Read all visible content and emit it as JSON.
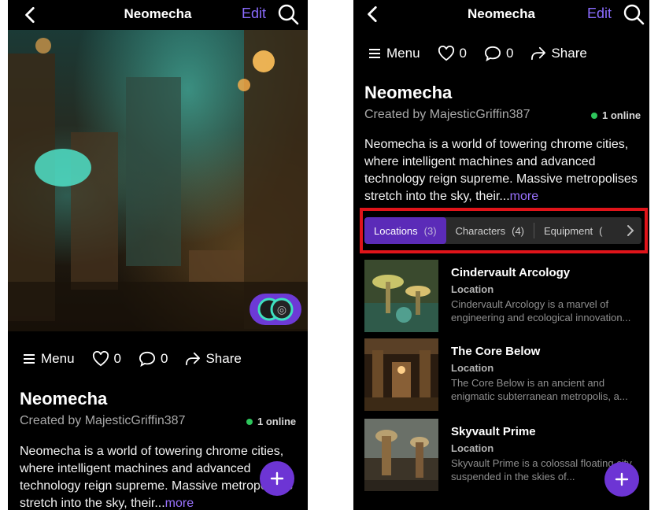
{
  "header": {
    "title": "Neomecha",
    "edit_label": "Edit"
  },
  "actions": {
    "menu_label": "Menu",
    "likes": "0",
    "comments": "0",
    "share_label": "Share"
  },
  "world": {
    "name": "Neomecha",
    "creator": "Created by MajesticGriffin387",
    "online": "1 online",
    "description_left": "Neomecha is a world of towering chrome cities, where intelligent machines and advanced technology reign supreme. Massive metropolises stretch into the sky, their...",
    "description_right": "Neomecha is a world of towering chrome cities, where intelligent machines and advanced technology reign supreme. Massive metropolises stretch into the sky, their...",
    "more_label": "more"
  },
  "tabs": [
    {
      "label": "Locations",
      "count": "(3)"
    },
    {
      "label": "Characters",
      "count": "(4)"
    },
    {
      "label": "Equipment",
      "count": "("
    }
  ],
  "items": [
    {
      "title": "Cindervault Arcology",
      "type": "Location",
      "description": "Cindervault Arcology is a marvel of engineering and ecological innovation..."
    },
    {
      "title": "The Core Below",
      "type": "Location",
      "description": "The Core Below is an ancient and enigmatic subterranean metropolis, a..."
    },
    {
      "title": "Skyvault Prime",
      "type": "Location",
      "description": "Skyvault Prime is a colossal floating city, suspended in the skies of..."
    }
  ],
  "colors": {
    "accent": "#8b6cff",
    "fab": "#6d35d4",
    "online_dot": "#2ec65c",
    "highlight": "#e0141a"
  },
  "icons": [
    "back-icon",
    "search-icon",
    "menu-icon",
    "heart-icon",
    "comment-icon",
    "share-icon",
    "plus-icon",
    "chevron-right-icon"
  ]
}
